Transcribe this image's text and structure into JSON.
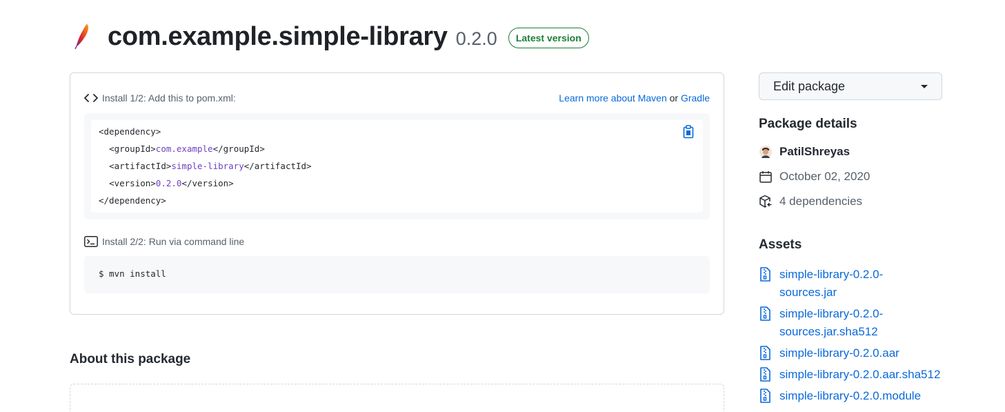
{
  "header": {
    "logo_icon": "apache-feather-icon",
    "package_name": "com.example.simple-library",
    "version": "0.2.0",
    "badge": "Latest version"
  },
  "install": {
    "step1_label": "Install 1/2: Add this to pom.xml:",
    "learn_more": "Learn more about Maven",
    "or": "or",
    "gradle": "Gradle",
    "code": {
      "open_dependency": "<dependency>",
      "group_open": "<groupId>",
      "group_value": "com.example",
      "group_close": "</groupId>",
      "artifact_open": "<artifactId>",
      "artifact_value": "simple-library",
      "artifact_close": "</artifactId>",
      "version_open": "<version>",
      "version_value": "0.2.0",
      "version_close": "</version>",
      "close_dependency": "</dependency>"
    },
    "step2_label": "Install 2/2: Run via command line",
    "command": "$ mvn install"
  },
  "about": {
    "title": "About this package"
  },
  "sidebar": {
    "edit_button": "Edit package",
    "details_title": "Package details",
    "author": "PatilShreyas",
    "date": "October 02, 2020",
    "dependencies": "4 dependencies",
    "assets_title": "Assets",
    "assets": [
      {
        "line1": "simple-library-0.2.0-",
        "line2": "sources.jar"
      },
      {
        "line1": "simple-library-0.2.0-",
        "line2": "sources.jar.sha512"
      },
      {
        "line1": "simple-library-0.2.0.aar",
        "line2": ""
      },
      {
        "line1": "simple-library-0.2.0.aar.sha512",
        "line2": ""
      },
      {
        "line1": "simple-library-0.2.0.module",
        "line2": ""
      }
    ]
  },
  "colors": {
    "link": "#0969da",
    "badge": "#1a7f37",
    "code_value": "#6f42c1"
  }
}
